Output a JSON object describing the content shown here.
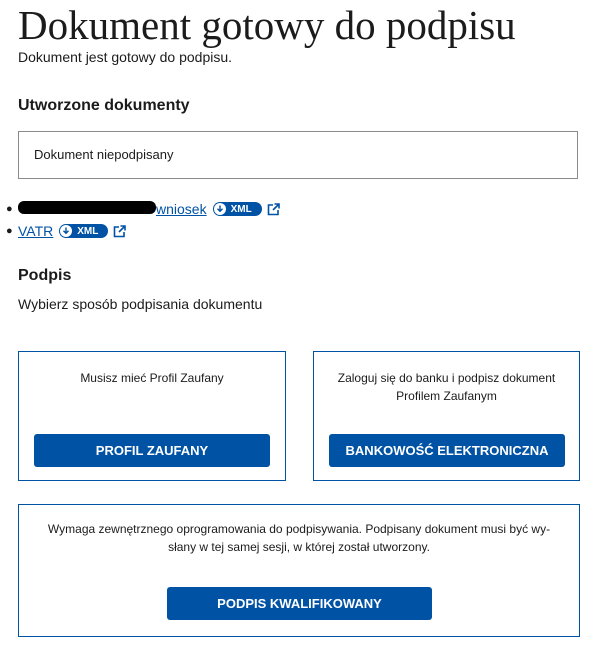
{
  "header": {
    "title": "Dokument gotowy do podpisu",
    "subtitle": "Dokument jest gotowy do podpisu."
  },
  "documents": {
    "heading": "Utworzone dokumenty",
    "status": "Dokument niepodpisany",
    "items": [
      {
        "name": "wniosek",
        "badge": "XML"
      },
      {
        "name": "VATR",
        "badge": "XML"
      }
    ]
  },
  "signature": {
    "heading": "Podpis",
    "instruction": "Wybierz sposób podpisania dokumentu",
    "options": [
      {
        "text": "Musisz mieć Profil Zaufany",
        "button": "PROFIL ZAUFANY"
      },
      {
        "text_line1": "Zaloguj się do banku i podpisz dokument",
        "text_line2": "Profilem Zaufanym",
        "button": "BANKOWOŚĆ ELEKTRONICZNA"
      },
      {
        "text_line1": "Wymaga zewnętrznego oprogramowania do podpisywania. Podpisany dokument musi być wy-",
        "text_line2": "słany w tej samej sesji, w której został utworzony.",
        "button": "PODPIS KWALIFIKOWANY"
      }
    ]
  },
  "colors": {
    "primary": "#0052a5",
    "text": "#1b1b1b",
    "border": "#8a8a8a"
  }
}
